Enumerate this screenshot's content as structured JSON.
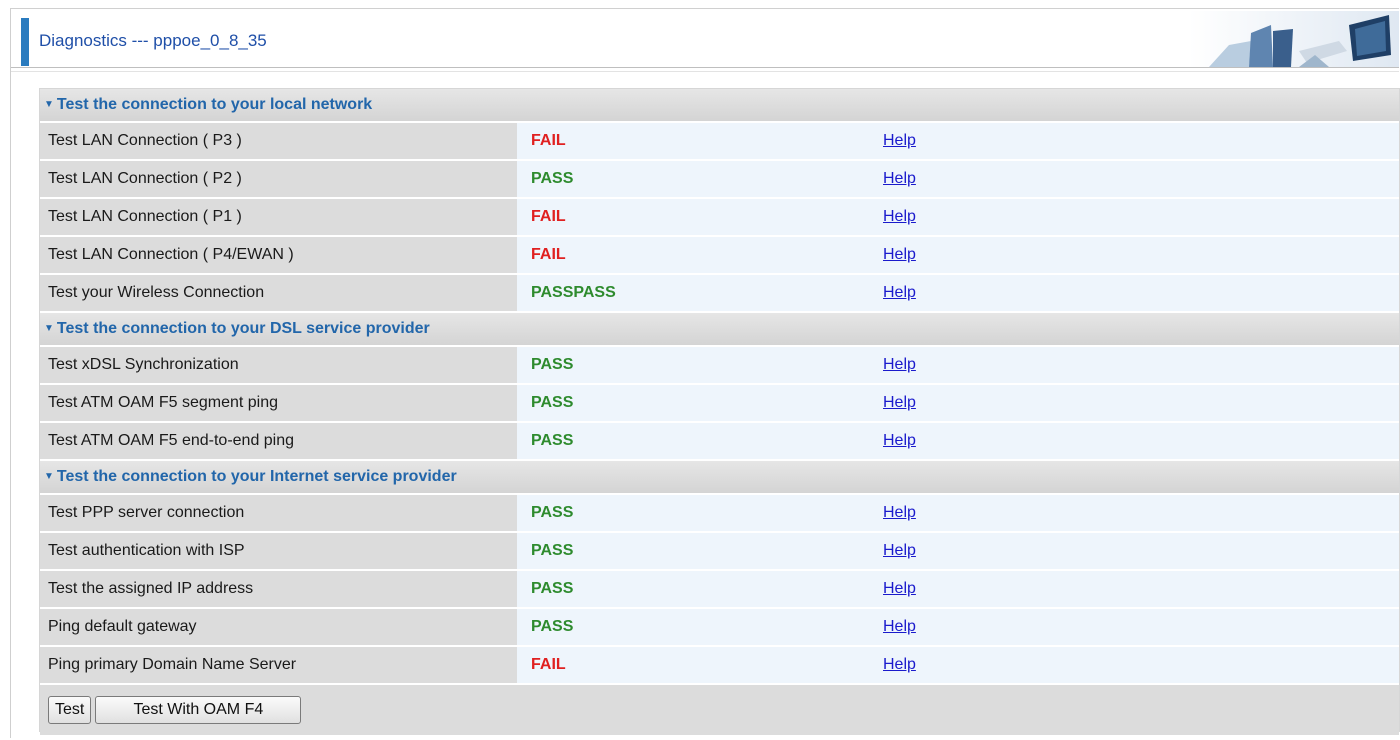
{
  "header": {
    "title": "Diagnostics --- pppoe_0_8_35"
  },
  "sections": [
    {
      "title": "Test the connection to your local network",
      "rows": [
        {
          "label": "Test LAN Connection ( P3 )",
          "status": "FAIL",
          "help": "Help"
        },
        {
          "label": "Test LAN Connection ( P2 )",
          "status": "PASS",
          "help": "Help"
        },
        {
          "label": "Test LAN Connection ( P1 )",
          "status": "FAIL",
          "help": "Help"
        },
        {
          "label": "Test LAN Connection ( P4/EWAN )",
          "status": "FAIL",
          "help": "Help"
        },
        {
          "label": "Test your Wireless Connection",
          "status": "PASSPASS",
          "help": "Help"
        }
      ]
    },
    {
      "title": "Test the connection to your DSL service provider",
      "rows": [
        {
          "label": "Test xDSL Synchronization",
          "status": "PASS",
          "help": "Help"
        },
        {
          "label": "Test ATM OAM F5 segment ping",
          "status": "PASS",
          "help": "Help"
        },
        {
          "label": "Test ATM OAM F5 end-to-end ping",
          "status": "PASS",
          "help": "Help"
        }
      ]
    },
    {
      "title": "Test the connection to your Internet service provider",
      "rows": [
        {
          "label": "Test PPP server connection",
          "status": "PASS",
          "help": "Help"
        },
        {
          "label": "Test authentication with ISP",
          "status": "PASS",
          "help": "Help"
        },
        {
          "label": "Test the assigned IP address",
          "status": "PASS",
          "help": "Help"
        },
        {
          "label": "Ping default gateway",
          "status": "PASS",
          "help": "Help"
        },
        {
          "label": "Ping primary Domain Name Server",
          "status": "FAIL",
          "help": "Help"
        }
      ]
    }
  ],
  "buttons": {
    "test_label": "Test",
    "test_oam_label": "Test With OAM F4"
  },
  "colors": {
    "pass": "#2e8b2e",
    "fail": "#e02020",
    "section_title": "#2266aa",
    "accent_bar": "#2a7bbf"
  },
  "icons": {
    "section_toggle": "triangle-down-icon",
    "logo": "computer-logo"
  }
}
